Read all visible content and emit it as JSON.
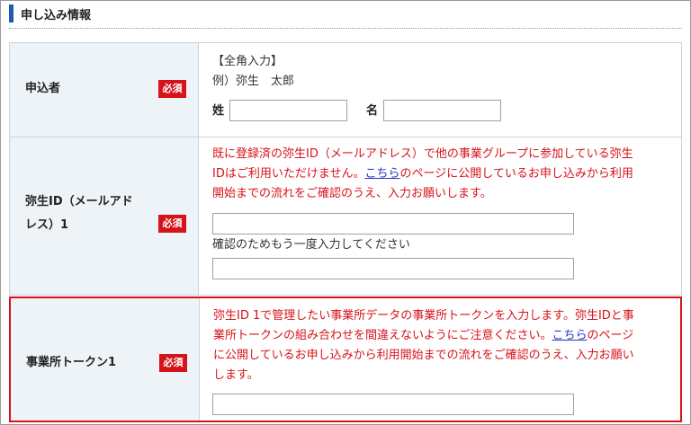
{
  "section": {
    "title": "申し込み情報"
  },
  "required_label": "必須",
  "applicant": {
    "label": "申込者",
    "hint_line1": "【全角入力】",
    "hint_line2": "例）弥生　太郎",
    "last_name_label": "姓",
    "first_name_label": "名",
    "last_name_value": "",
    "first_name_value": ""
  },
  "yayoi_id": {
    "label_line1": "弥生ID（メールアド",
    "label_line2": "レス）1",
    "notice_line1": "既に登録済の弥生ID（メールアドレス）で他の事業グループに参加している弥生",
    "notice_line2_pre": "IDはご利用いただけません。",
    "notice_link": "こちら",
    "notice_line2_post": "のページに公開しているお申し込みから利用",
    "notice_line3": "開始までの流れをご確認のうえ、入力お願いします。",
    "email_value": "",
    "confirm_label": "確認のためもう一度入力してください",
    "confirm_value": ""
  },
  "office_token": {
    "label": "事業所トークン1",
    "notice_line1": "弥生ID 1で管理したい事業所データの事業所トークンを入力します。弥生IDと事",
    "notice_line2_pre": "業所トークンの組み合わせを間違えないようにご注意ください。",
    "notice_link": "こちら",
    "notice_line2_post": "のページ",
    "notice_line3": "に公開しているお申し込みから利用開始までの流れをご確認のうえ、入力お願い",
    "notice_line4": "します。",
    "token_value": ""
  },
  "colors": {
    "accent_blue": "#1e5aa8",
    "required_red": "#d6121a",
    "label_bg": "#eef3f7",
    "link": "#2a36c0"
  }
}
